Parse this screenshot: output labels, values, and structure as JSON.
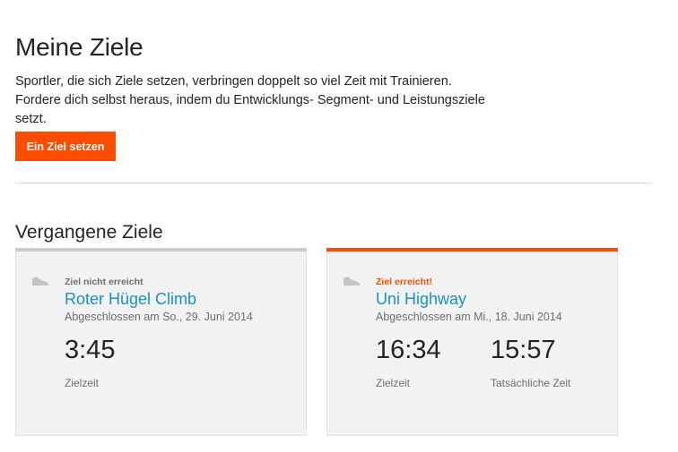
{
  "header": {
    "title": "Meine Ziele",
    "intro": "Sportler, die sich Ziele setzen, verbringen doppelt so viel Zeit mit Trainieren. Fordere dich selbst heraus, indem du Entwicklungs- Segment- und Leistungsziele setzt.",
    "cta_label": "Ein Ziel setzen"
  },
  "past": {
    "title": "Vergangene Ziele",
    "goals": [
      {
        "status": "Ziel nicht erreicht",
        "name": "Roter Hügel Climb",
        "completed": "Abgeschlossen am So., 29. Juni 2014",
        "target_time": "3:45",
        "target_label": "Zielzeit"
      },
      {
        "status": "Ziel erreicht!",
        "name": "Uni Highway",
        "completed": "Abgeschlossen am Mi., 18. Juni 2014",
        "target_time": "16:34",
        "target_label": "Zielzeit",
        "actual_time": "15:57",
        "actual_label": "Tatsächliche Zeit"
      }
    ]
  },
  "colors": {
    "accent": "#fc4c02",
    "link": "#1a91c4",
    "missed_bar": "#cccccc",
    "card_bg": "#f2f2f2"
  },
  "icons": {
    "goal_type": "running-shoe-icon"
  }
}
